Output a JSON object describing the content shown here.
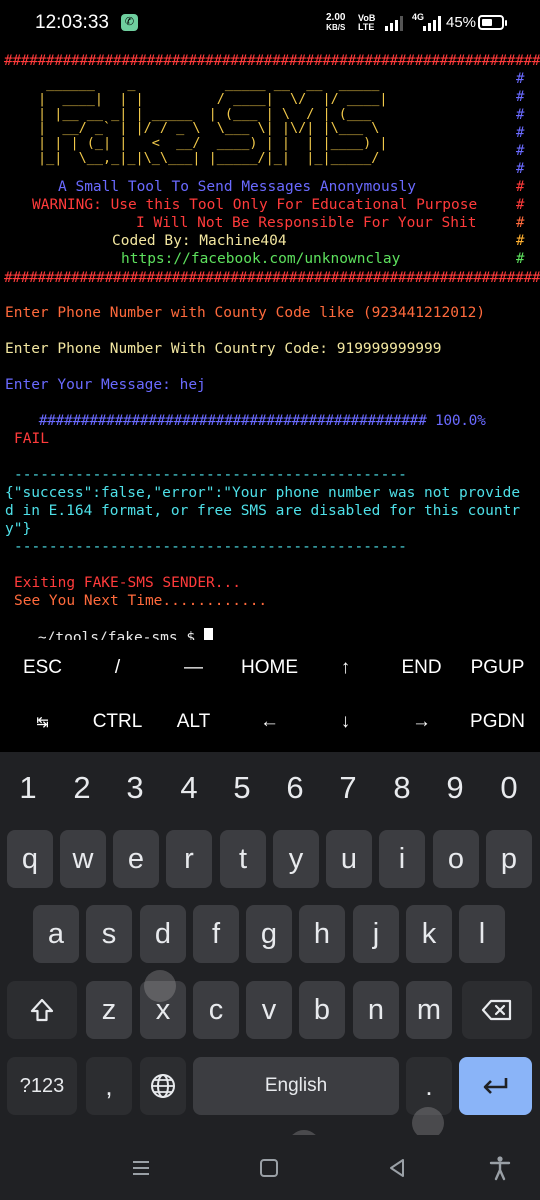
{
  "status_bar": {
    "time": "12:03:33",
    "net_speed_value": "2.00",
    "net_speed_unit": "KB/S",
    "volte_top": "VoB",
    "volte_bottom": "LTE",
    "network": "4G",
    "battery": "45%"
  },
  "terminal": {
    "hash_line": "################################################################",
    "ascii_art": " ______    _           _____ __  __  _____\n|  ____|  | |         / ____|  \\/  |/ ____|\n| |__ __ _| | _____  | (___ | \\  / | (___\n|  __/ _` | |/ / _ \\  \\___ \\| |\\/| |\\___ \\\n| | | (_| |   <  __/  ____) | |  | |____) |\n|_|  \\__,_|_|\\_\\___| |_____/|_|  |_|_____/",
    "banner_right_hash": "#",
    "tagline": "A Small Tool To Send Messages Anonymously",
    "warning": "WARNING: Use this Tool Only For Educational Purpose",
    "disclaimer": "I Will Not Be Responsible For Your Shit",
    "coded_by": "Coded By: Machine404",
    "link": "https://facebook.com/unknownclay",
    "prompt_hint": "Enter Phone Number with County Code like (923441212012)",
    "phone_prompt": "Enter Phone Number With Country Code: 919999999999",
    "message_prompt": "Enter Your Message: hej",
    "progress_bar": "##############################################",
    "progress_pct": "100.0%",
    "fail": "FAIL",
    "dash_line": "---------------------------------------------",
    "response_line1": "{\"success\":false,\"error\":\"Your phone number was not provide",
    "response_line2": "d in E.164 format, or free SMS are disabled for this countr",
    "response_line3": "y\"}",
    "exiting": "Exiting FAKE-SMS SENDER...",
    "see_you": "See You Next Time............",
    "shell_prompt": "~/tools/fake-sms $ "
  },
  "extra_keys": {
    "row1": [
      "ESC",
      "/",
      "—",
      "HOME",
      "↑",
      "END",
      "PGUP"
    ],
    "row2": [
      "↹",
      "CTRL",
      "ALT",
      "←",
      "↓",
      "→",
      "PGDN"
    ]
  },
  "keyboard": {
    "numbers": [
      "1",
      "2",
      "3",
      "4",
      "5",
      "6",
      "7",
      "8",
      "9",
      "0"
    ],
    "row1": [
      "q",
      "w",
      "e",
      "r",
      "t",
      "y",
      "u",
      "i",
      "o",
      "p"
    ],
    "row2": [
      "a",
      "s",
      "d",
      "f",
      "g",
      "h",
      "j",
      "k",
      "l"
    ],
    "row3": [
      "z",
      "x",
      "c",
      "v",
      "b",
      "n",
      "m"
    ],
    "symbols_key": "?123",
    "comma_key": ",",
    "space_label": "English",
    "period_key": "."
  }
}
